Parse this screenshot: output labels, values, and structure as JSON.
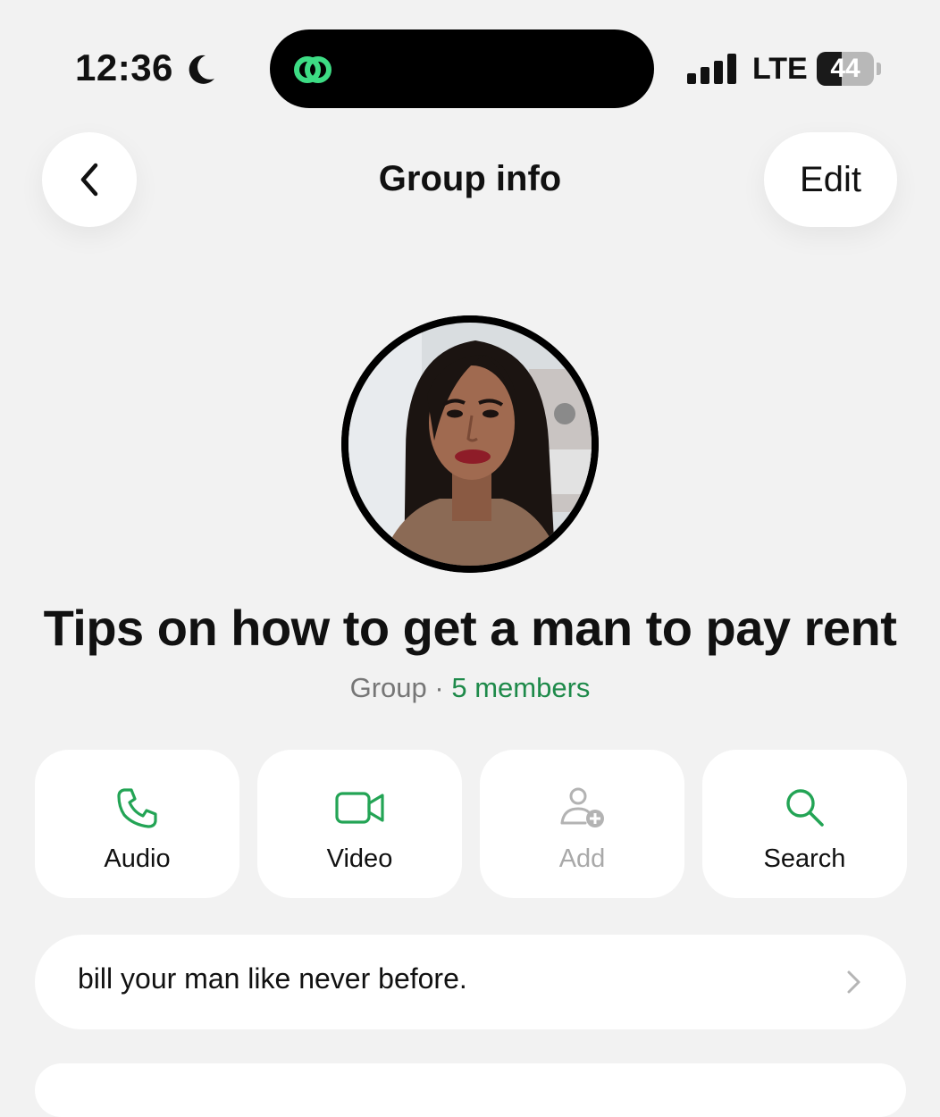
{
  "status_bar": {
    "time": "12:36",
    "network": "LTE",
    "battery": "44",
    "battery_level": 0.44,
    "moon_icon": "moon-icon",
    "signal_icon": "signal-icon",
    "accent": "#3ddc84"
  },
  "nav": {
    "title": "Group info",
    "edit_label": "Edit",
    "back_icon": "chevron-left-icon"
  },
  "group": {
    "name": "Tips on how to get a man to pay rent",
    "type": "Group",
    "separator": "·",
    "members": "5 members"
  },
  "actions": [
    {
      "label": "Audio",
      "icon": "phone-icon",
      "enabled": true
    },
    {
      "label": "Video",
      "icon": "video-camera-icon",
      "enabled": true
    },
    {
      "label": "Add",
      "icon": "add-person-icon",
      "enabled": false
    },
    {
      "label": "Search",
      "icon": "search-icon",
      "enabled": true
    }
  ],
  "description": {
    "text": "bill your man like never before."
  },
  "colors": {
    "accent_green": "#1e8a4a",
    "icon_green": "#23a455",
    "background": "#f2f2f2"
  }
}
